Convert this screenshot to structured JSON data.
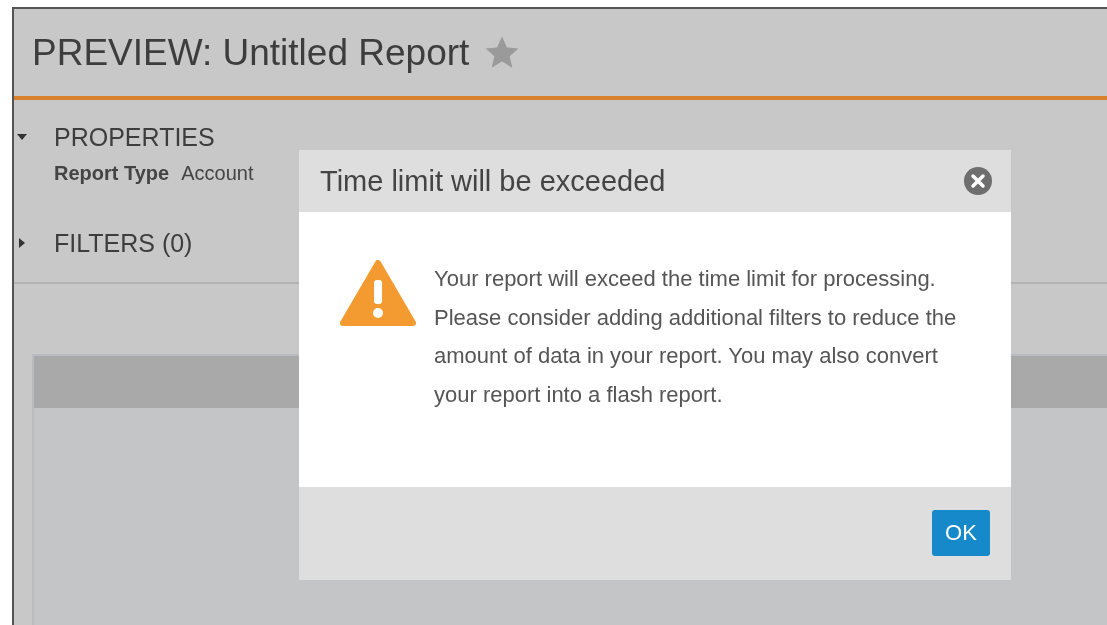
{
  "header": {
    "title": "PREVIEW: Untitled Report",
    "starred": false
  },
  "sections": [
    {
      "label": "PROPERTIES",
      "expanded": true,
      "fields": [
        {
          "label": "Report Type",
          "value": "Account"
        }
      ]
    },
    {
      "label": "FILTERS (0)",
      "expanded": false
    }
  ],
  "dialog": {
    "title": "Time limit will be exceeded",
    "message": "Your report will exceed the time limit for processing. Please consider adding additional filters to reduce the amount of data in your report. You may also convert your report into a flash report.",
    "buttons": [
      "OK"
    ]
  }
}
